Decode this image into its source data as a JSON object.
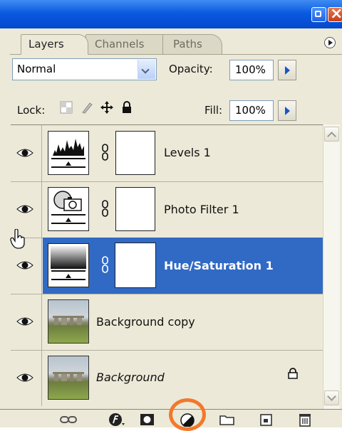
{
  "window": {
    "minimize_label": "",
    "close_label": ""
  },
  "tabs": [
    {
      "label": "Layers",
      "active": true
    },
    {
      "label": "Channels",
      "active": false
    },
    {
      "label": "Paths",
      "active": false
    }
  ],
  "blend": {
    "mode": "Normal",
    "opacity_label": "Opacity:",
    "opacity_value": "100%"
  },
  "lock": {
    "label": "Lock:",
    "fill_label": "Fill:",
    "fill_value": "100%"
  },
  "layers": [
    {
      "name": "Levels 1",
      "type": "adjustment-levels",
      "visible": true,
      "selected": false
    },
    {
      "name": "Photo Filter 1",
      "type": "adjustment-photo-filter",
      "visible": true,
      "selected": false
    },
    {
      "name": "Hue/Saturation 1",
      "type": "adjustment-hue-saturation",
      "visible": true,
      "selected": true
    },
    {
      "name": "Background copy",
      "type": "pixel",
      "visible": true,
      "selected": false
    },
    {
      "name": "Background",
      "type": "pixel-locked",
      "visible": true,
      "selected": false,
      "italic": true
    }
  ],
  "colors": {
    "selection": "#316ac5",
    "panel": "#ece9d8",
    "highlight_ring": "#f2792b",
    "titlebar": "#0a5ae0"
  },
  "bottom_icons": [
    "link-layers-icon",
    "layer-style-icon",
    "add-mask-icon",
    "new-adjustment-layer-icon",
    "new-group-icon",
    "new-layer-icon",
    "delete-layer-icon"
  ]
}
